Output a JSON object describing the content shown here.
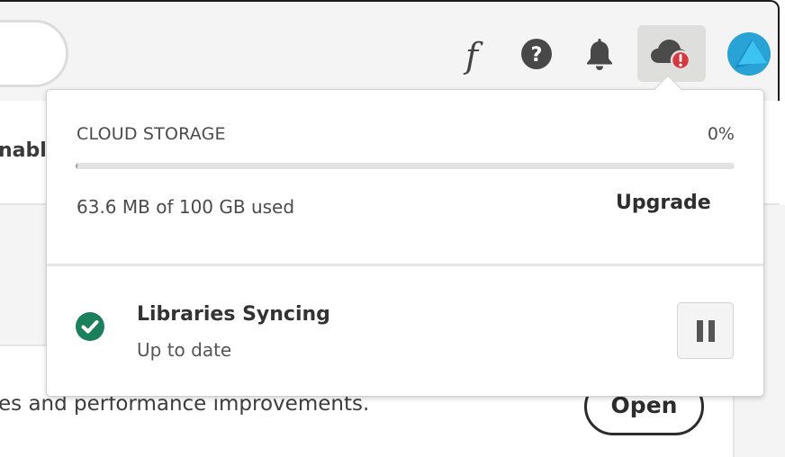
{
  "header": {
    "icons": [
      "fonts-icon",
      "help-icon",
      "bell-icon",
      "cloud-sync-error-icon",
      "avatar"
    ],
    "colors": {
      "error_badge": "#d7373f",
      "avatar": "#29a3d6"
    }
  },
  "background": {
    "enable_text": "nabl",
    "note_text": "es and performance improvements.",
    "open_label": "Open"
  },
  "popover": {
    "storage": {
      "title": "CLOUD STORAGE",
      "percent": "0%",
      "used_fraction": 0.0006,
      "used_text": "63.6 MB of 100 GB used",
      "upgrade_label": "Upgrade"
    },
    "sync": {
      "title": "Libraries Syncing",
      "status": "Up to date",
      "status_color": "#1a7f5a",
      "pause_icon": "pause-icon"
    }
  }
}
